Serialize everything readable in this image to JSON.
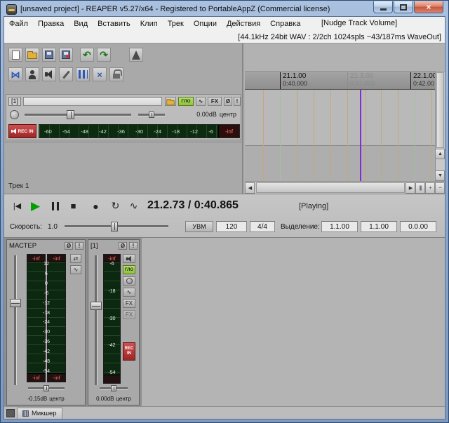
{
  "window": {
    "title": "[unsaved project] - REAPER v5.27/x64 - Registered to PortableAppZ (Commercial license)",
    "close_glyph": "×"
  },
  "menu": {
    "items": [
      "Файл",
      "Правка",
      "Вид",
      "Вставить",
      "Клип",
      "Трек",
      "Опции",
      "Действия",
      "Справка"
    ],
    "right_label": "[Nudge Track Volume]"
  },
  "audio_status": "[44.1kHz 24bit WAV : 2/2ch 1024spls ~43/187ms WaveOut]",
  "icons": {
    "prev": "|◀",
    "play": "▶",
    "stop": "■",
    "record": "●",
    "loop": "↻",
    "envelope": "∿",
    "undo": "↶",
    "redo": "↷",
    "bowtie": "⋈",
    "cross": "×",
    "mute": "Ø",
    "solo": "!",
    "route": "⇄",
    "up": "▲",
    "down": "▼",
    "left": "◀",
    "right": "▶",
    "plus": "+",
    "minus": "−",
    "zoom_bars": "|||"
  },
  "track_panel": {
    "number": "[1]",
    "io": "ГЛО",
    "fx": "FX",
    "volume": "0.00dB",
    "pan": "центр",
    "rec_in": "REC IN",
    "meter": {
      "scale": [
        "-60",
        "-54",
        "-48",
        "-42",
        "-36",
        "-30",
        "-24",
        "-18",
        "-12",
        "-6"
      ],
      "peak": "-inf"
    },
    "footer": "Трек 1"
  },
  "ruler": {
    "markers": [
      {
        "bar": "21.1.00",
        "time": "0:40.000"
      },
      {
        "bar": "21.3.00",
        "time": "0:41.000"
      },
      {
        "bar": "22.1.00",
        "time": "0:42.00"
      }
    ]
  },
  "transport": {
    "time": "21.2.73 / 0:40.865",
    "status": "[Playing]",
    "rate_label": "Скорость:",
    "rate": "1.0",
    "bpm_mode": "УВМ",
    "bpm": "120",
    "timesig": "4/4",
    "selection_label": "Выделение:",
    "sel_start": "1.1.00",
    "sel_end": "1.1.00",
    "sel_length": "0.0.00"
  },
  "mixer": {
    "master": {
      "label": "МАСТЕР",
      "peak_left": "-inf",
      "peak_right": "-inf",
      "rms_left": "-inf",
      "rms_right": "-inf",
      "scale": [
        "12",
        "6",
        "0",
        "-6",
        "-12",
        "-18",
        "-24",
        "-30",
        "-36",
        "-42",
        "-48",
        "-54"
      ],
      "volume": "-0.15dB",
      "pan": "центр"
    },
    "track1": {
      "label": "[1]",
      "peak": "-inf",
      "scale": [
        "-6",
        "-18",
        "-30",
        "-42",
        "-54"
      ],
      "io": "ГЛО",
      "fx": "FX",
      "rec_in_1": "REC",
      "rec_in_2": "IN",
      "volume": "0.00dB",
      "pan": "центр"
    }
  },
  "statusbar": {
    "tab": "Микшер"
  }
}
